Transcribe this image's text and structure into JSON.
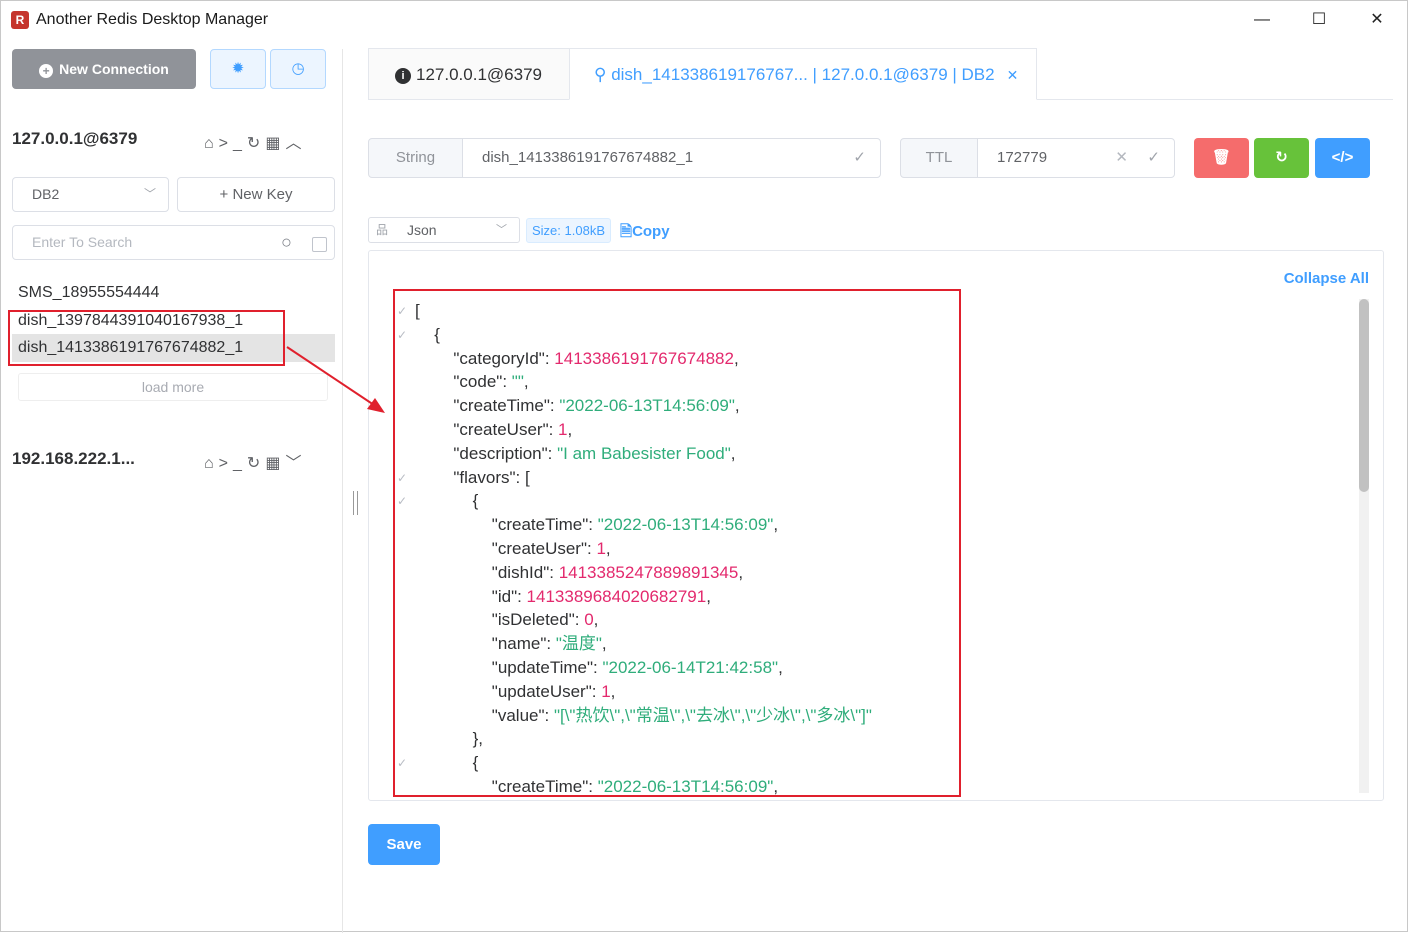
{
  "window": {
    "title": "Another Redis Desktop Manager",
    "minimize": "—",
    "maximize": "☐",
    "close": "✕"
  },
  "sidebar": {
    "new_connection": "New Connection",
    "connections": [
      {
        "name": "127.0.0.1@6379",
        "expanded": true
      },
      {
        "name": "192.168.222.1...",
        "expanded": false
      }
    ],
    "db_select": "DB2",
    "new_key": "+ New Key",
    "search_placeholder": "Enter To Search",
    "keys": [
      "SMS_18955554444",
      "dish_1397844391040167938_1",
      "dish_1413386191767674882_1"
    ],
    "load_more": "load more"
  },
  "tabs": [
    {
      "label": "127.0.0.1@6379",
      "active": false
    },
    {
      "label": "dish_141338619176767... | 127.0.0.1@6379 | DB2",
      "active": true
    }
  ],
  "key_header": {
    "type": "String",
    "key": "dish_1413386191767674882_1",
    "ttl_label": "TTL",
    "ttl": "172779"
  },
  "viewer": {
    "format": "Json",
    "size": "Size: 1.08kB",
    "copy": "Copy",
    "collapse_all": "Collapse All",
    "lines": [
      {
        "fold": true,
        "indent": 0,
        "parts": [
          [
            "p",
            "["
          ]
        ]
      },
      {
        "fold": true,
        "indent": 1,
        "parts": [
          [
            "p",
            "{"
          ]
        ]
      },
      {
        "fold": false,
        "indent": 2,
        "parts": [
          [
            "k",
            "\"categoryId\": "
          ],
          [
            "n",
            "1413386191767674882"
          ],
          [
            "p",
            ","
          ]
        ]
      },
      {
        "fold": false,
        "indent": 2,
        "parts": [
          [
            "k",
            "\"code\": "
          ],
          [
            "s",
            "\"\""
          ],
          [
            "p",
            ","
          ]
        ]
      },
      {
        "fold": false,
        "indent": 2,
        "parts": [
          [
            "k",
            "\"createTime\": "
          ],
          [
            "s",
            "\"2022-06-13T14:56:09\""
          ],
          [
            "p",
            ","
          ]
        ]
      },
      {
        "fold": false,
        "indent": 2,
        "parts": [
          [
            "k",
            "\"createUser\": "
          ],
          [
            "n",
            "1"
          ],
          [
            "p",
            ","
          ]
        ]
      },
      {
        "fold": false,
        "indent": 2,
        "parts": [
          [
            "k",
            "\"description\": "
          ],
          [
            "s",
            "\"I am Babesister Food\""
          ],
          [
            "p",
            ","
          ]
        ]
      },
      {
        "fold": true,
        "indent": 2,
        "parts": [
          [
            "k",
            "\"flavors\": "
          ],
          [
            "p",
            "["
          ]
        ]
      },
      {
        "fold": true,
        "indent": 3,
        "parts": [
          [
            "p",
            "{"
          ]
        ]
      },
      {
        "fold": false,
        "indent": 4,
        "parts": [
          [
            "k",
            "\"createTime\": "
          ],
          [
            "s",
            "\"2022-06-13T14:56:09\""
          ],
          [
            "p",
            ","
          ]
        ]
      },
      {
        "fold": false,
        "indent": 4,
        "parts": [
          [
            "k",
            "\"createUser\": "
          ],
          [
            "n",
            "1"
          ],
          [
            "p",
            ","
          ]
        ]
      },
      {
        "fold": false,
        "indent": 4,
        "parts": [
          [
            "k",
            "\"dishId\": "
          ],
          [
            "n",
            "1413385247889891345"
          ],
          [
            "p",
            ","
          ]
        ]
      },
      {
        "fold": false,
        "indent": 4,
        "parts": [
          [
            "k",
            "\"id\": "
          ],
          [
            "n",
            "1413389684020682791"
          ],
          [
            "p",
            ","
          ]
        ]
      },
      {
        "fold": false,
        "indent": 4,
        "parts": [
          [
            "k",
            "\"isDeleted\": "
          ],
          [
            "n",
            "0"
          ],
          [
            "p",
            ","
          ]
        ]
      },
      {
        "fold": false,
        "indent": 4,
        "parts": [
          [
            "k",
            "\"name\": "
          ],
          [
            "s",
            "\"温度\""
          ],
          [
            "p",
            ","
          ]
        ]
      },
      {
        "fold": false,
        "indent": 4,
        "parts": [
          [
            "k",
            "\"updateTime\": "
          ],
          [
            "s",
            "\"2022-06-14T21:42:58\""
          ],
          [
            "p",
            ","
          ]
        ]
      },
      {
        "fold": false,
        "indent": 4,
        "parts": [
          [
            "k",
            "\"updateUser\": "
          ],
          [
            "n",
            "1"
          ],
          [
            "p",
            ","
          ]
        ]
      },
      {
        "fold": false,
        "indent": 4,
        "parts": [
          [
            "k",
            "\"value\": "
          ],
          [
            "s",
            "\"[\\\"热饮\\\",\\\"常温\\\",\\\"去冰\\\",\\\"少冰\\\",\\\"多冰\\\"]\""
          ]
        ]
      },
      {
        "fold": false,
        "indent": 3,
        "parts": [
          [
            "p",
            "},"
          ]
        ]
      },
      {
        "fold": true,
        "indent": 3,
        "parts": [
          [
            "p",
            "{"
          ]
        ]
      },
      {
        "fold": false,
        "indent": 4,
        "parts": [
          [
            "k",
            "\"createTime\": "
          ],
          [
            "s",
            "\"2022-06-13T14:56:09\""
          ],
          [
            "p",
            ","
          ]
        ]
      }
    ]
  },
  "save": "Save",
  "colors": {
    "accent": "#409eff",
    "danger": "#f56c6c",
    "success": "#67c23a",
    "json_number": "#e3296d",
    "json_string": "#2fad7b",
    "annotation": "#e0202d"
  }
}
